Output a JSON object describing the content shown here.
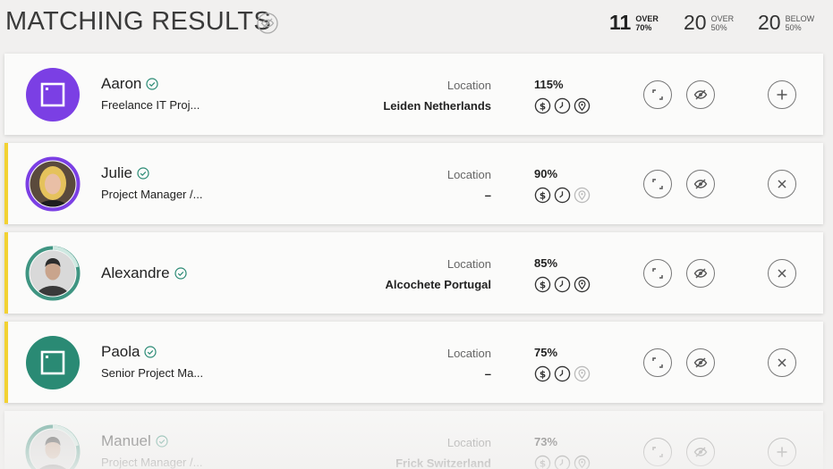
{
  "header": {
    "title": "MATCHING RESULTS",
    "title_icon": "eye-off-icon",
    "stats": [
      {
        "value": "11",
        "top": "OVER",
        "bottom": "70%",
        "active": true
      },
      {
        "value": "20",
        "top": "OVER",
        "bottom": "50%",
        "active": false
      },
      {
        "value": "20",
        "top": "BELOW",
        "bottom": "50%",
        "active": false
      }
    ]
  },
  "colors": {
    "accent_yellow": "#f2d233",
    "purple": "#7b3fe4",
    "teal": "#2a8a74",
    "check": "#2a8a74"
  },
  "results": [
    {
      "name": "Aaron",
      "role": "Freelance IT Proj...",
      "location_label": "Location",
      "location": "Leiden Netherlands",
      "percent": "115%",
      "avatar": "placeholder",
      "ring": "#7b3fe4",
      "flagged": false,
      "action": "add",
      "location_known": true
    },
    {
      "name": "Julie",
      "role": "Project Manager /...",
      "location_label": "Location",
      "location": "–",
      "percent": "90%",
      "avatar": "photo",
      "ring": "#7b3fe4",
      "flagged": true,
      "action": "remove",
      "location_known": false
    },
    {
      "name": "Alexandre",
      "role": "",
      "location_label": "Location",
      "location": "Alcochete Portugal",
      "percent": "85%",
      "avatar": "photo",
      "ring": "#2a8a74",
      "flagged": true,
      "action": "remove",
      "location_known": true
    },
    {
      "name": "Paola",
      "role": "Senior Project Ma...",
      "location_label": "Location",
      "location": "–",
      "percent": "75%",
      "avatar": "placeholder",
      "ring": "#2a8a74",
      "flagged": true,
      "action": "remove",
      "location_known": false
    },
    {
      "name": "Manuel",
      "role": "Project Manager /...",
      "location_label": "Location",
      "location": "Frick Switzerland",
      "percent": "73%",
      "avatar": "photo",
      "ring": "#2a8a74",
      "flagged": false,
      "action": "add",
      "location_known": true
    }
  ],
  "icons": {
    "budget": "dollar-icon",
    "availability": "clock-icon",
    "location": "map-pin-icon",
    "expand": "expand-icon",
    "hide": "eye-off-icon",
    "add": "plus-icon",
    "remove": "close-icon",
    "verified": "check-circle-icon"
  }
}
